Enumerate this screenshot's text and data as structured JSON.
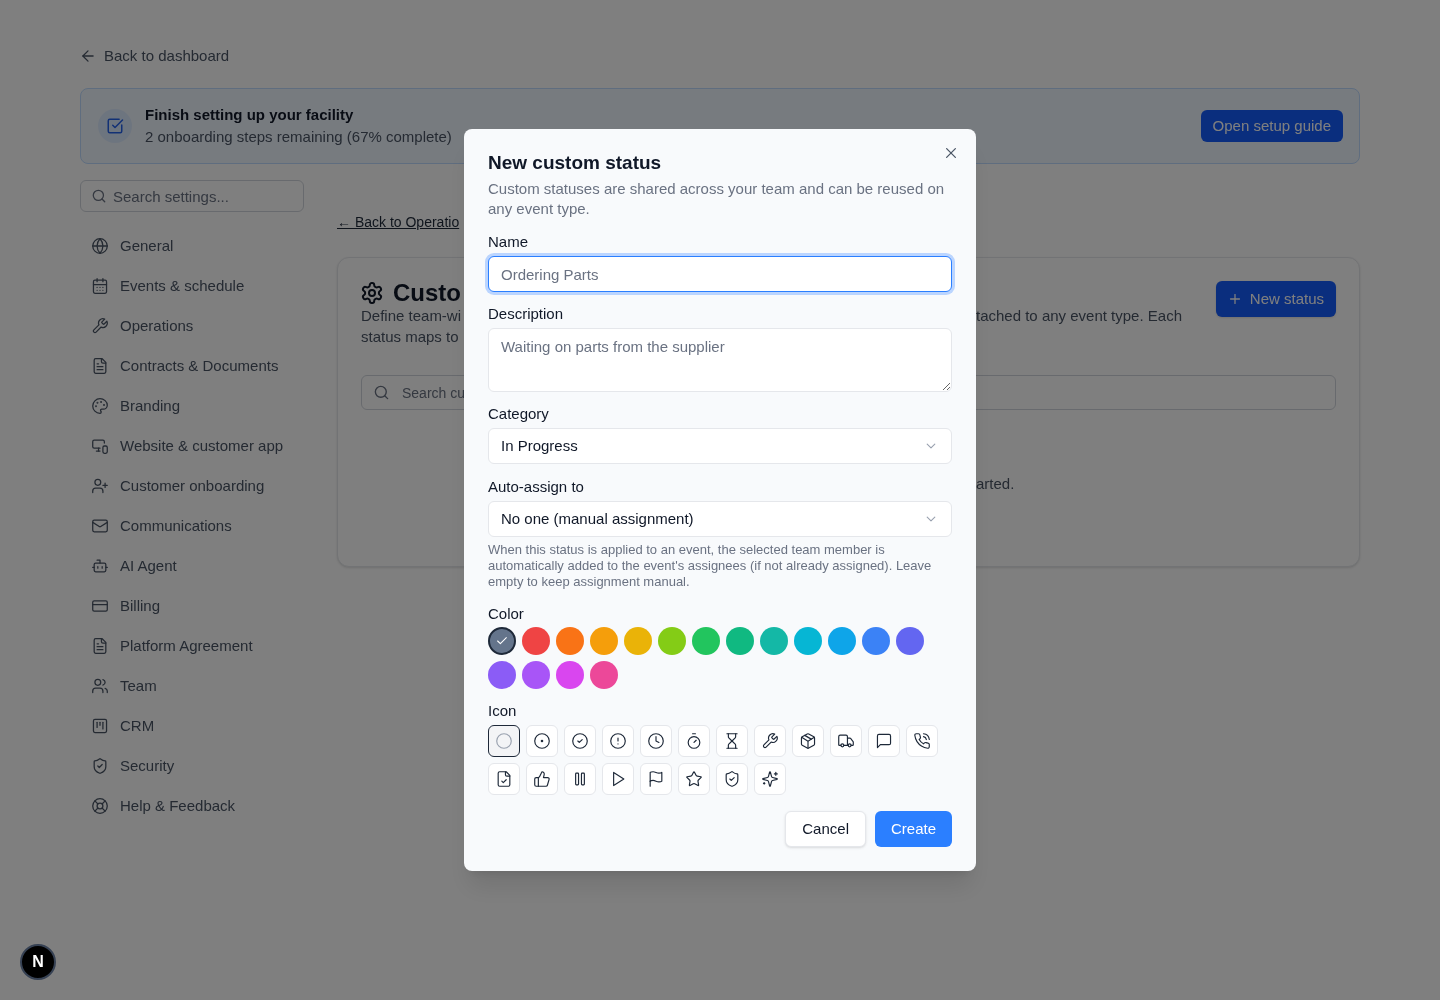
{
  "back_link": {
    "label": "Back to dashboard"
  },
  "setup_banner": {
    "title": "Finish setting up your facility",
    "subtitle": "2 onboarding steps remaining (67% complete)",
    "button": "Open setup guide"
  },
  "sidebar": {
    "search": {
      "placeholder": "Search settings..."
    },
    "items": [
      {
        "label": "General"
      },
      {
        "label": "Events & schedule"
      },
      {
        "label": "Operations"
      },
      {
        "label": "Contracts & Documents"
      },
      {
        "label": "Branding"
      },
      {
        "label": "Website & customer app"
      },
      {
        "label": "Customer onboarding"
      },
      {
        "label": "Communications"
      },
      {
        "label": "AI Agent"
      },
      {
        "label": "Billing"
      },
      {
        "label": "Platform Agreement"
      },
      {
        "label": "Team"
      },
      {
        "label": "CRM"
      },
      {
        "label": "Security"
      },
      {
        "label": "Help & Feedback"
      }
    ]
  },
  "main": {
    "back_link": "← Back to Operatio",
    "card": {
      "title": "Custo",
      "description_left": [
        "Define team-wi",
        "status maps to"
      ],
      "description_right": "tached to any event type. Each",
      "button": "New status",
      "search": {
        "placeholder": "Search cu"
      },
      "empty_state": "arted."
    }
  },
  "dialog": {
    "title": "New custom status",
    "description": "Custom statuses are shared across your team and can be reused on any event type.",
    "name": {
      "label": "Name",
      "placeholder": "Ordering Parts",
      "focused": true
    },
    "description_field": {
      "label": "Description",
      "placeholder": "Waiting on parts from the supplier"
    },
    "category": {
      "label": "Category",
      "value": "In Progress"
    },
    "auto_assign": {
      "label": "Auto-assign to",
      "value": "No one (manual assignment)",
      "help": "When this status is applied to an event, the selected team member is automatically added to the event's assignees (if not already assigned). Leave empty to keep assignment manual."
    },
    "color": {
      "label": "Color",
      "swatches": [
        {
          "color": "#64748b",
          "selected": true
        },
        {
          "color": "#ef4444",
          "selected": false
        },
        {
          "color": "#f97316",
          "selected": false
        },
        {
          "color": "#f59e0b",
          "selected": false
        },
        {
          "color": "#eab308",
          "selected": false
        },
        {
          "color": "#84cc16",
          "selected": false
        },
        {
          "color": "#22c55e",
          "selected": false
        },
        {
          "color": "#10b981",
          "selected": false
        },
        {
          "color": "#14b8a6",
          "selected": false
        },
        {
          "color": "#06b6d4",
          "selected": false
        },
        {
          "color": "#0ea5e9",
          "selected": false
        },
        {
          "color": "#3b82f6",
          "selected": false
        },
        {
          "color": "#6366f1",
          "selected": false
        },
        {
          "color": "#8b5cf6",
          "selected": false
        },
        {
          "color": "#a855f7",
          "selected": false
        },
        {
          "color": "#d946ef",
          "selected": false
        },
        {
          "color": "#ec4899",
          "selected": false
        }
      ]
    },
    "icon": {
      "label": "Icon",
      "options": [
        {
          "selected": true
        },
        {
          "selected": false
        },
        {
          "selected": false
        },
        {
          "selected": false
        },
        {
          "selected": false
        },
        {
          "selected": false
        },
        {
          "selected": false
        },
        {
          "selected": false
        },
        {
          "selected": false
        },
        {
          "selected": false
        },
        {
          "selected": false
        },
        {
          "selected": false
        },
        {
          "selected": false
        },
        {
          "selected": false
        },
        {
          "selected": false
        },
        {
          "selected": false
        },
        {
          "selected": false
        },
        {
          "selected": false
        },
        {
          "selected": false
        },
        {
          "selected": false
        }
      ]
    },
    "buttons": [
      {
        "label": "Cancel",
        "kind": "secondary"
      },
      {
        "label": "Create",
        "kind": "primary"
      }
    ]
  },
  "dev_badge": {
    "label": "N"
  }
}
